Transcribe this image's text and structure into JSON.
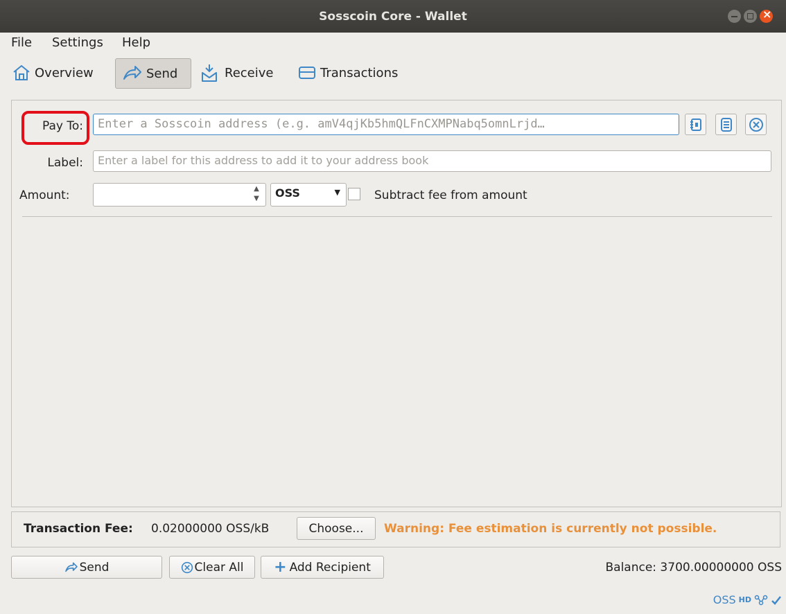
{
  "window": {
    "title": "Sosscoin Core - Wallet"
  },
  "menu": {
    "file": "File",
    "settings": "Settings",
    "help": "Help"
  },
  "toolbar": {
    "overview": "Overview",
    "send": "Send",
    "receive": "Receive",
    "transactions": "Transactions"
  },
  "form": {
    "payto_label": "Pay To:",
    "payto_placeholder": "Enter a Sosscoin address (e.g. amV4qjKb5hmQLFnCXMPNabq5omnLrjd…",
    "label_label": "Label:",
    "label_placeholder": "Enter a label for this address to add it to your address book",
    "amount_label": "Amount:",
    "amount_value": "",
    "unit": "OSS",
    "subtract_fee_label": "Subtract fee from amount",
    "subtract_fee_checked": false
  },
  "fee": {
    "label": "Transaction Fee:",
    "value": "0.02000000 OSS/kB",
    "choose_button": "Choose...",
    "warning": "Warning: Fee estimation is currently not possible."
  },
  "actions": {
    "send": "Send",
    "clear_all": "Clear All",
    "add_recipient": "Add Recipient"
  },
  "balance": "Balance: 3700.00000000 OSS",
  "statusbar": {
    "unit": "OSS",
    "hd": "HD"
  },
  "colors": {
    "accent": "#3f88c8",
    "warning": "#e8913a",
    "highlight": "#e3101a",
    "titlebar": "#3d3b37"
  }
}
